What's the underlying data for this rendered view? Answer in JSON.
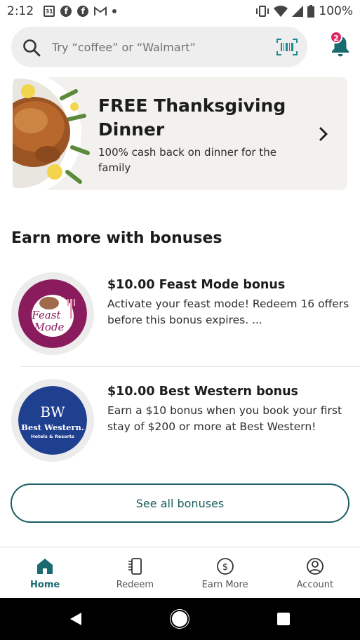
{
  "status_bar": {
    "time": "2:12",
    "calendar_day": "31",
    "battery_percent": "100%"
  },
  "search": {
    "placeholder": "Try “coffee” or “Walmart”"
  },
  "notifications": {
    "badge_count": "2"
  },
  "promo": {
    "title": "FREE Thanksgiving Dinner",
    "subtitle": "100% cash back on dinner for the family"
  },
  "bonuses_section": {
    "title": "Earn more with bonuses",
    "items": [
      {
        "title": "$10.00 Feast Mode bonus",
        "description": "Activate your feast mode! Redeem 16 offers before this bonus expires. ...",
        "logo_text_line1": "Feast",
        "logo_text_line2": "Mode"
      },
      {
        "title": "$10.00 Best Western bonus",
        "description": "Earn a $10 bonus when you book your first stay of $200 or more at Best Western!",
        "logo_mark": "BW",
        "logo_name": "Best Western.",
        "logo_tagline": "Hotels & Resorts"
      }
    ],
    "see_all_label": "See all bonuses"
  },
  "bottom_nav": {
    "items": [
      {
        "label": "Home",
        "icon": "home-icon",
        "active": true
      },
      {
        "label": "Redeem",
        "icon": "receipt-phone-icon",
        "active": false
      },
      {
        "label": "Earn More",
        "icon": "dollar-circle-icon",
        "active": false
      },
      {
        "label": "Account",
        "icon": "person-circle-icon",
        "active": false
      }
    ]
  },
  "colors": {
    "brand_teal": "#1a6b70",
    "badge_red": "#e0245e",
    "feast_purple": "#8a1b5c",
    "best_western_blue": "#1f3f8f"
  }
}
